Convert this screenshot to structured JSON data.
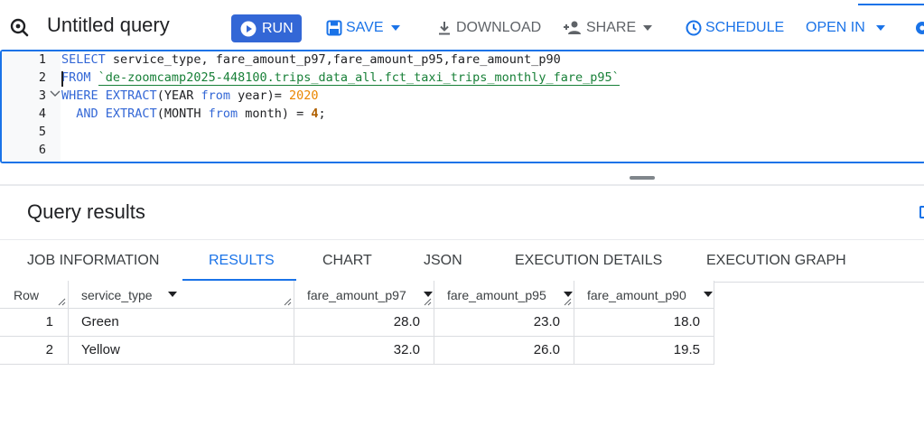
{
  "toolbar": {
    "title": "Untitled query",
    "run_label": "RUN",
    "save_label": "SAVE",
    "download_label": "DOWNLOAD",
    "share_label": "SHARE",
    "schedule_label": "SCHEDULE",
    "open_in_label": "OPEN IN"
  },
  "editor": {
    "line_numbers": [
      "1",
      "2",
      "3",
      "4",
      "5",
      "6"
    ],
    "lines": [
      [
        {
          "t": "SELECT",
          "c": "kw"
        },
        {
          "t": " service_type, fare_amount_p97,fare_amount_p95,fare_amount_p90",
          "c": ""
        }
      ],
      [
        {
          "t": "FROM",
          "c": "kw"
        },
        {
          "t": " ",
          "c": ""
        },
        {
          "t": "`de-zoomcamp2025-448100.trips_data_all.fct_taxi_trips_monthly_fare_p95`",
          "c": "str"
        }
      ],
      [
        {
          "t": "WHERE",
          "c": "kw"
        },
        {
          "t": " ",
          "c": ""
        },
        {
          "t": "EXTRACT",
          "c": "kw"
        },
        {
          "t": "(YEAR ",
          "c": ""
        },
        {
          "t": "from",
          "c": "kw"
        },
        {
          "t": " year)= ",
          "c": ""
        },
        {
          "t": "2020",
          "c": "kwo"
        }
      ],
      [
        {
          "t": "  ",
          "c": ""
        },
        {
          "t": "AND",
          "c": "kw"
        },
        {
          "t": " ",
          "c": ""
        },
        {
          "t": "EXTRACT",
          "c": "kw"
        },
        {
          "t": "(MONTH ",
          "c": ""
        },
        {
          "t": "from",
          "c": "kw"
        },
        {
          "t": " month) = ",
          "c": ""
        },
        {
          "t": "4",
          "c": "num"
        },
        {
          "t": ";",
          "c": ""
        }
      ],
      [],
      []
    ]
  },
  "results": {
    "title": "Query results",
    "tabs": [
      "JOB INFORMATION",
      "RESULTS",
      "CHART",
      "JSON",
      "EXECUTION DETAILS",
      "EXECUTION GRAPH"
    ],
    "active_tab": "RESULTS",
    "columns": [
      "Row",
      "service_type",
      "fare_amount_p97",
      "fare_amount_p95",
      "fare_amount_p90"
    ],
    "rows": [
      [
        "1",
        "Green",
        "28.0",
        "23.0",
        "18.0"
      ],
      [
        "2",
        "Yellow",
        "32.0",
        "26.0",
        "19.5"
      ]
    ]
  },
  "colors": {
    "accent": "#1a73e8",
    "run_button": "#3367d6",
    "string_literal": "#188038",
    "number_literal": "#b06000"
  }
}
